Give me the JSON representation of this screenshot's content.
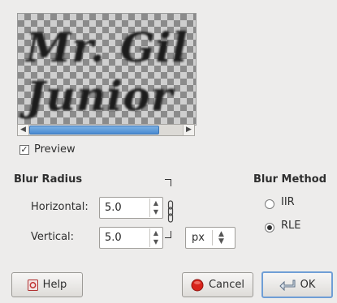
{
  "preview": {
    "text_line1": "Mr. Gil",
    "text_line2": "Junior",
    "checkbox_label": "Preview",
    "checked": true
  },
  "blur_radius": {
    "title": "Blur Radius",
    "horizontal_label": "Horizontal:",
    "horizontal_value": "5.0",
    "vertical_label": "Vertical:",
    "vertical_value": "5.0",
    "unit": "px"
  },
  "blur_method": {
    "title": "Blur Method",
    "options": [
      "IIR",
      "RLE"
    ],
    "selected": "RLE"
  },
  "buttons": {
    "help": "Help",
    "cancel": "Cancel",
    "ok": "OK"
  },
  "icons": {
    "help": "help-book-icon",
    "cancel": "cancel-icon",
    "ok": "ok-arrow-icon",
    "chain": "chain-link-icon"
  }
}
